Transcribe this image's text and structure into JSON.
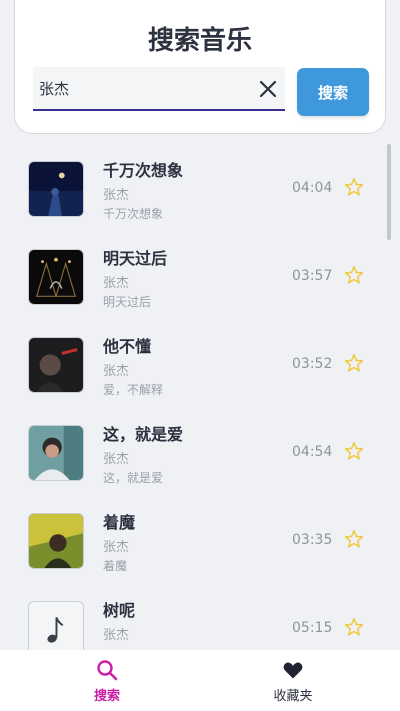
{
  "header": {
    "title": "搜索音乐"
  },
  "search": {
    "value": "张杰",
    "button_label": "搜索"
  },
  "songs": [
    {
      "title": "千万次想象",
      "artist": "张杰",
      "album": "千万次想象",
      "duration": "04:04",
      "cover": "dark-blue-night"
    },
    {
      "title": "明天过后",
      "artist": "张杰",
      "album": "明天过后",
      "duration": "03:57",
      "cover": "dark-stage-lights"
    },
    {
      "title": "他不懂",
      "artist": "张杰",
      "album": "爱，不解释",
      "duration": "03:52",
      "cover": "dark-portrait-love"
    },
    {
      "title": "这，就是爱",
      "artist": "张杰",
      "album": "这，就是爱",
      "duration": "04:54",
      "cover": "teal-portrait"
    },
    {
      "title": "着魔",
      "artist": "张杰",
      "album": "着魔",
      "duration": "03:35",
      "cover": "yellow-green-photo"
    },
    {
      "title": "树呢",
      "artist": "张杰",
      "album": "",
      "duration": "05:15",
      "cover": "music-note-placeholder"
    }
  ],
  "nav": {
    "tabs": [
      {
        "label": "搜索",
        "icon": "search-icon",
        "active": true
      },
      {
        "label": "收藏夹",
        "icon": "heart-icon",
        "active": false
      }
    ]
  },
  "colors": {
    "accent": "#3f98db",
    "active_tab": "#cc1fa6",
    "star": "#f0c93a",
    "input_underline": "#3a2f8f"
  }
}
